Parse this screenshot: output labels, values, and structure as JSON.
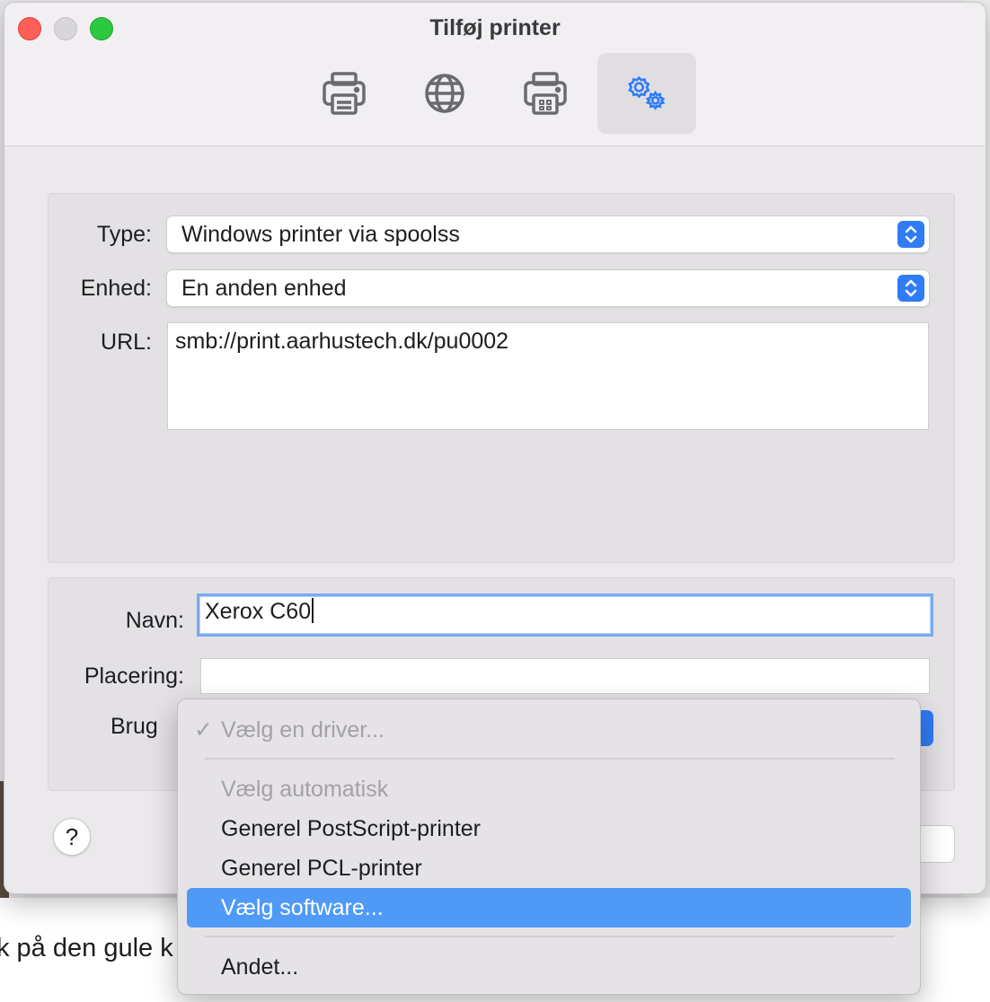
{
  "window": {
    "title": "Tilføj printer"
  },
  "toolbar": {
    "items": [
      {
        "name": "default",
        "icon": "printer-icon"
      },
      {
        "name": "ip",
        "icon": "globe-icon"
      },
      {
        "name": "windows",
        "icon": "windows-printer-icon"
      },
      {
        "name": "advanced",
        "icon": "gears-icon",
        "active": true
      }
    ]
  },
  "form": {
    "type_label": "Type:",
    "type_value": "Windows printer via spoolss",
    "device_label": "Enhed:",
    "device_value": "En anden enhed",
    "url_label": "URL:",
    "url_value": "smb://print.aarhustech.dk/pu0002",
    "name_label": "Navn:",
    "name_value": "Xerox C60",
    "location_label": "Placering:",
    "location_value": "",
    "use_label": "Brug",
    "help_label": "?"
  },
  "driver_menu": {
    "items": [
      {
        "label": "Vælg en driver...",
        "checked": true,
        "disabled": true
      },
      {
        "label": "Vælg automatisk",
        "disabled": true
      },
      {
        "label": "Generel PostScript-printer"
      },
      {
        "label": "Generel PCL-printer"
      },
      {
        "label": "Vælg software...",
        "highlighted": true
      },
      {
        "label": "Andet..."
      }
    ],
    "check_glyph": "✓"
  },
  "background": {
    "text": "k på den gule k"
  },
  "colors": {
    "accent": "#2f7cf6",
    "highlight": "#4f9af6",
    "close": "#fe5f57",
    "maximize": "#2bc840"
  }
}
